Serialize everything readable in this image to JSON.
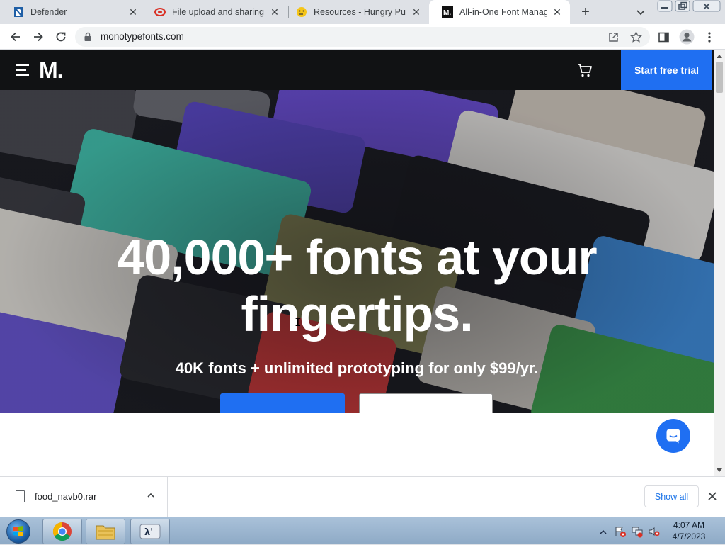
{
  "browser": {
    "tabs": [
      {
        "title": "Defender",
        "active": false
      },
      {
        "title": "File upload and sharing. I",
        "active": false
      },
      {
        "title": "Resources - Hungry Pum",
        "active": false
      },
      {
        "title": "All-in-One Font Manager",
        "active": true
      }
    ],
    "url": "monotypefonts.com"
  },
  "site": {
    "logo": "M.",
    "trial_button": "Start free trial",
    "hero_title": "40,000+ fonts at your fingertips.",
    "hero_subtitle": "40K fonts + unlimited prototyping for only $99/yr."
  },
  "downloads": {
    "file_name": "food_navb0.rar",
    "show_all": "Show all"
  },
  "taskbar": {
    "time": "4:07 AM",
    "date": "4/7/2023"
  },
  "colors": {
    "accent": "#1f6ff2",
    "header_bg": "#111214"
  }
}
